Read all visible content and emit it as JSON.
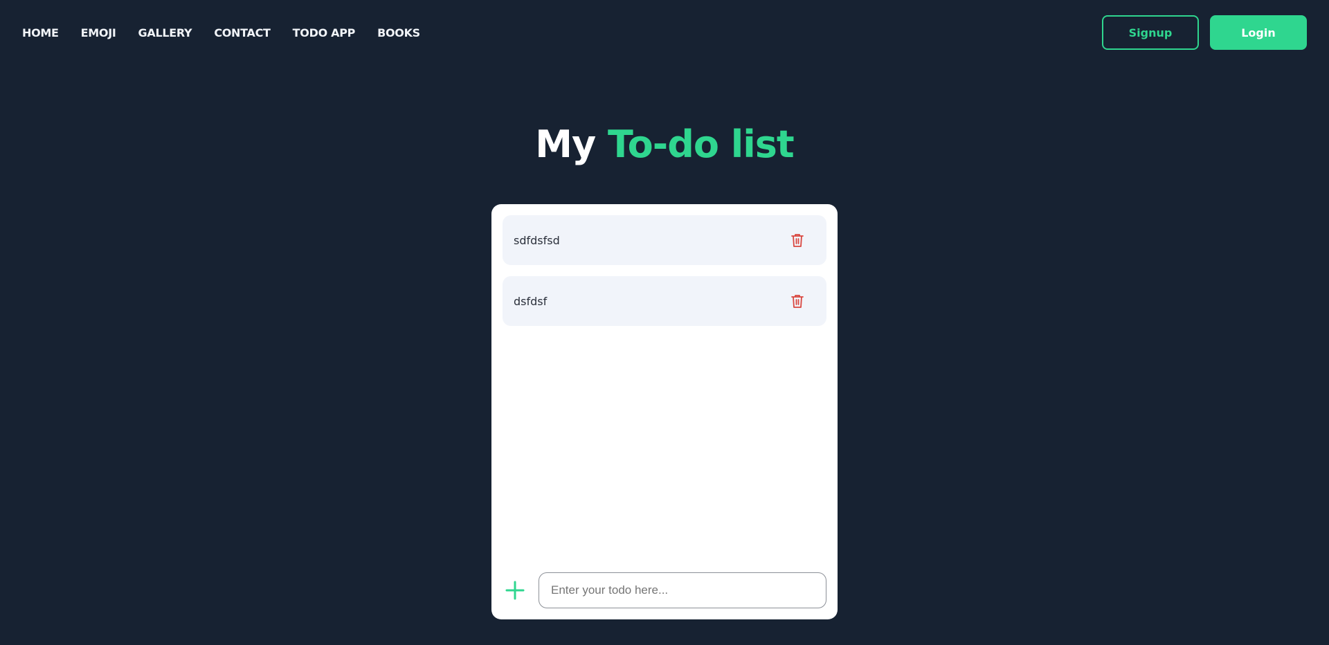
{
  "nav": {
    "links": [
      "HOME",
      "EMOJI",
      "GALLERY",
      "CONTACT",
      "TODO APP",
      "BOOKS"
    ],
    "signup_label": "Signup",
    "login_label": "Login"
  },
  "heading": {
    "part1": "My",
    "part2": "To-do list"
  },
  "todos": [
    {
      "text": "sdfdsfsd"
    },
    {
      "text": "dsfdsf"
    }
  ],
  "input": {
    "placeholder": "Enter your todo here...",
    "value": ""
  },
  "icons": {
    "delete": "trash-icon",
    "add": "plus-icon"
  },
  "colors": {
    "background": "#172232",
    "accent": "#2fd68f",
    "danger": "#d9453e",
    "item_bg": "#f1f4fa"
  }
}
